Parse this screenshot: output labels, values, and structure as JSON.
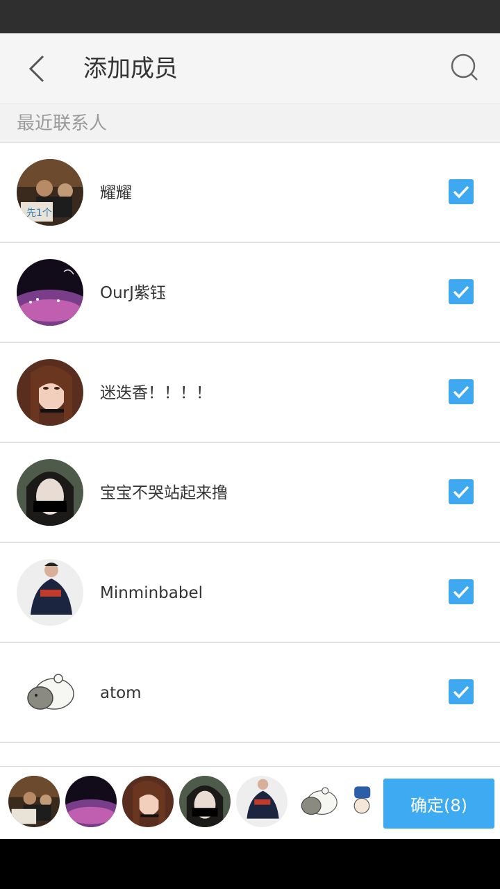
{
  "header": {
    "title": "添加成员",
    "back_icon": "chevron-left-icon",
    "search_icon": "search-icon"
  },
  "section": {
    "label": "最近联系人"
  },
  "contacts": [
    {
      "name": "耀耀",
      "checked": true
    },
    {
      "name": "OurJ紫钰",
      "checked": true
    },
    {
      "name": "迷迭香！！！！",
      "checked": true
    },
    {
      "name": "宝宝不哭站起来撸",
      "checked": true
    },
    {
      "name": "Minminbabel",
      "checked": true
    },
    {
      "name": "atom",
      "checked": true
    }
  ],
  "footer": {
    "confirm_label": "确定(8)"
  },
  "colors": {
    "accent": "#3ea8f0",
    "status_bar": "#2f2f2f",
    "header_bg": "#f5f5f5"
  }
}
